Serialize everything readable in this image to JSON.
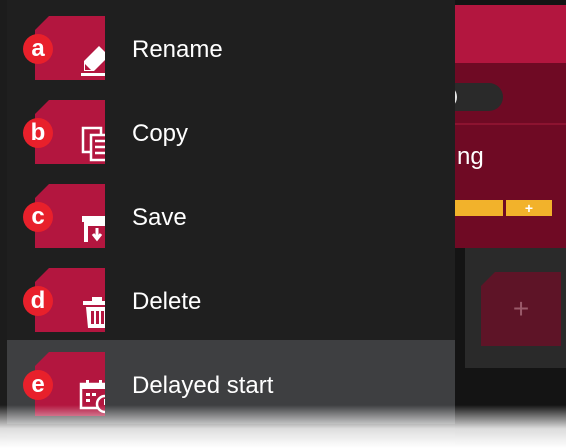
{
  "background": {
    "partial_label": "ng",
    "plus_label": "+",
    "tile_plus": "+"
  },
  "menu": {
    "items": [
      {
        "badge": "a",
        "label": "Rename",
        "icon": "rename-pencil-icon"
      },
      {
        "badge": "b",
        "label": "Copy",
        "icon": "copy-icon"
      },
      {
        "badge": "c",
        "label": "Save",
        "icon": "save-icon"
      },
      {
        "badge": "d",
        "label": "Delete",
        "icon": "trash-icon"
      },
      {
        "badge": "e",
        "label": "Delayed start",
        "icon": "calendar-clock-icon",
        "selected": true
      }
    ]
  },
  "colors": {
    "accent": "#b3163f",
    "badge": "#e8202b",
    "menu_bg": "#1f1f1f",
    "selected_bg": "#3e3f41",
    "bar": "#f2b22b"
  }
}
